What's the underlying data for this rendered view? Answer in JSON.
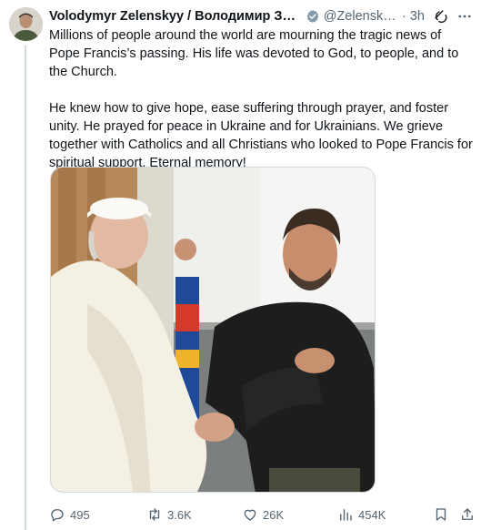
{
  "author": {
    "name": "Volodymyr Zelenskyy / Володимир Зеленський",
    "handle": "@ZelenskyyUa",
    "time": "3h"
  },
  "post": {
    "paragraph1": "Millions of people around the world are mourning the tragic news of Pope Francis’s passing. His life was devoted to God, to people, and to the Church.",
    "paragraph2": "He knew how to give hope, ease suffering through prayer, and foster unity. He prayed for peace in Ukraine and for Ukrainians. We grieve together with Catholics and all Christians who looked to Pope Francis for spiritual support. Eternal memory!"
  },
  "media": {
    "description_icon": "photo"
  },
  "actions": {
    "replies": "495",
    "reposts": "3.6K",
    "likes": "26K",
    "views": "454K"
  },
  "icons": {
    "verified": "verified-badge-icon",
    "grok": "grok-icon",
    "more": "more-icon",
    "reply": "reply-icon",
    "repost": "repost-icon",
    "like": "heart-icon",
    "views": "views-icon",
    "bookmark": "bookmark-icon",
    "share": "share-icon"
  },
  "colors": {
    "text": "#0f1419",
    "secondary": "#536471",
    "border": "#cfd9de",
    "badge": "#829aab"
  }
}
